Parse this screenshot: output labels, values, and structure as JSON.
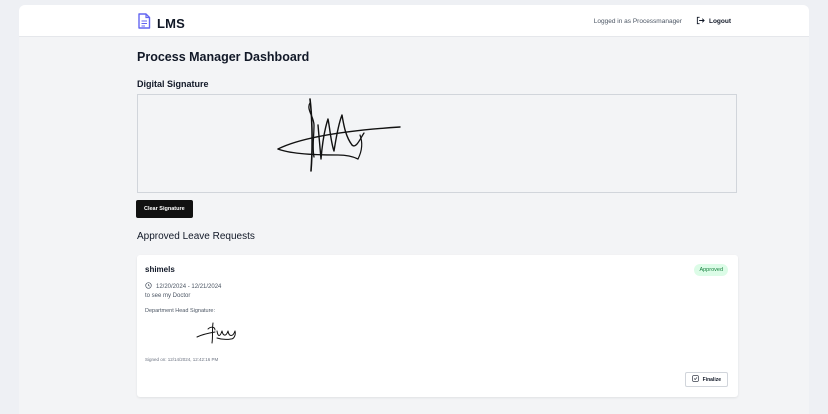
{
  "header": {
    "brand": "LMS",
    "logged_in_text": "Logged in as Processmanager",
    "logout_label": "Logout"
  },
  "page": {
    "title": "Process Manager Dashboard",
    "signature_label": "Digital Signature",
    "clear_button": "Clear Signature",
    "approved_title": "Approved Leave Requests"
  },
  "requests": [
    {
      "name": "shimels",
      "status": "Approved",
      "dates": "12/20/2024 - 12/21/2024",
      "reason": "to see my Doctor",
      "signature_label": "Department Head Signature:",
      "signed_on": "Signed on: 12/14/2024, 12:42:16 PM",
      "finalize_label": "Finalize"
    }
  ],
  "colors": {
    "approved_bg": "#dcfce7",
    "approved_text": "#15803d",
    "button_dark": "#111111"
  }
}
